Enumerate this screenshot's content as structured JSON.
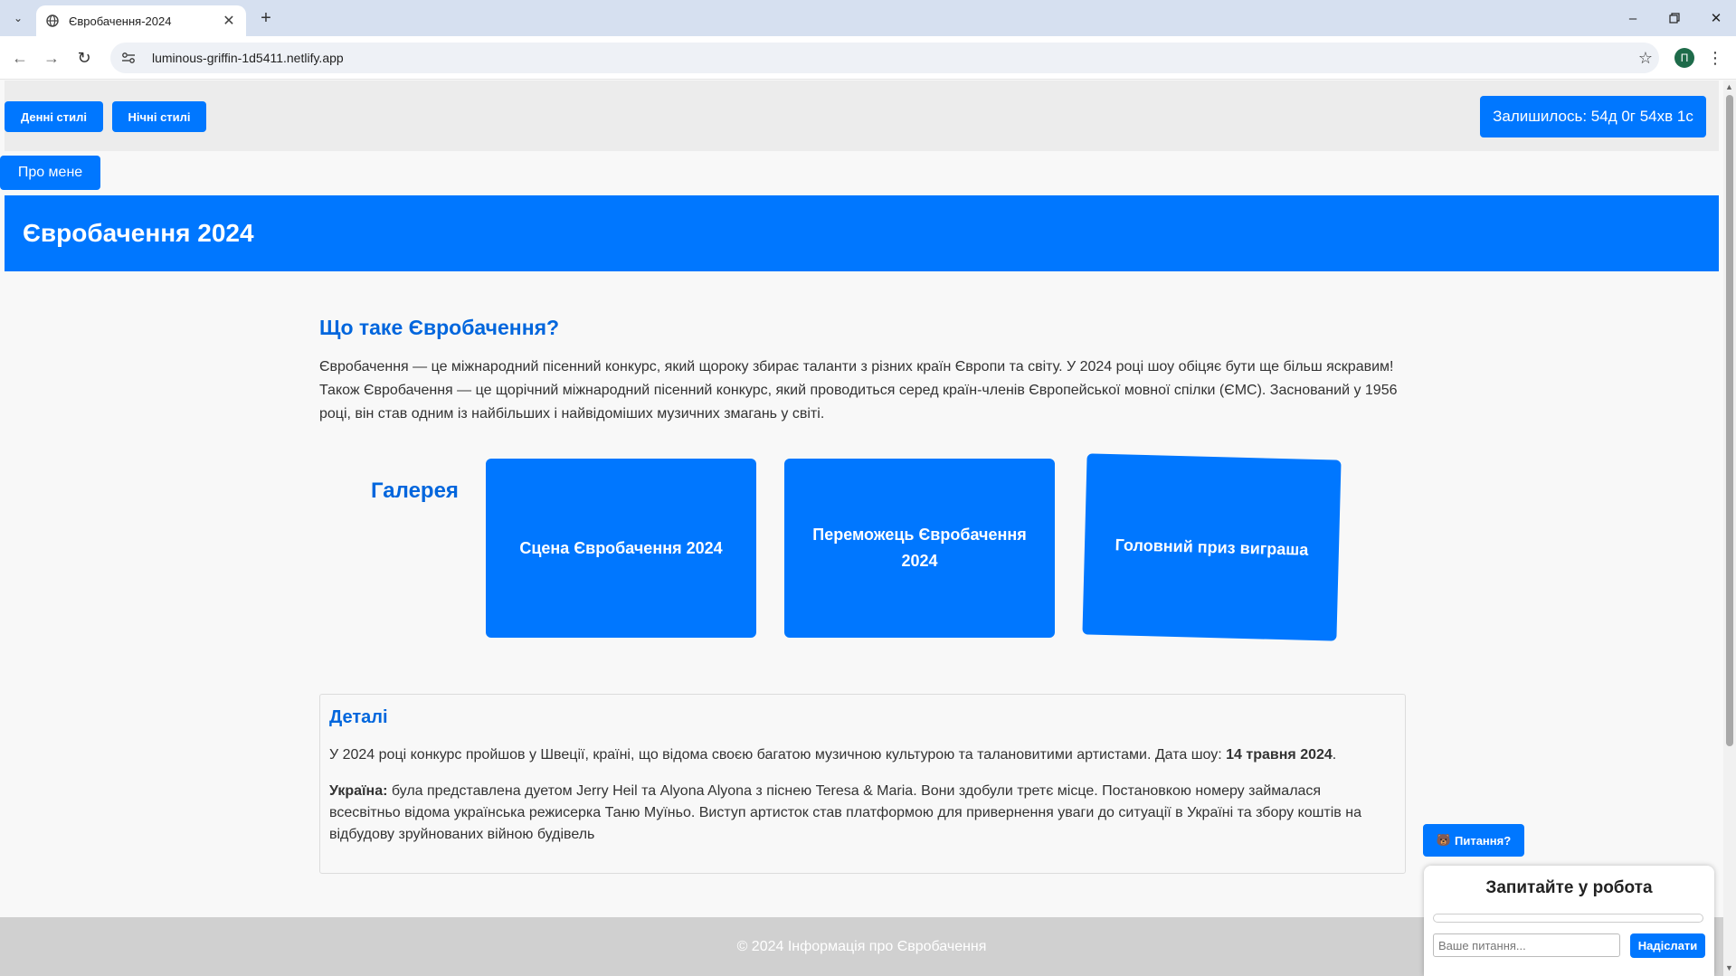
{
  "browser": {
    "tab_title": "Євробачення-2024",
    "url": "luminous-griffin-1d5411.netlify.app",
    "profile_initial": "П"
  },
  "header": {
    "day_styles_label": "Денні стилі",
    "night_styles_label": "Нічні стилі",
    "countdown_label": "Залишилось: 54д 0г 54хв 1с",
    "about_label": "Про мене",
    "site_title": "Євробачення 2024"
  },
  "intro": {
    "heading": "Що таке Євробачення?",
    "text": "Євробачення — це міжнародний пісенний конкурс, який щороку збирає таланти з різних країн Європи та світу. У 2024 році шоу обіцяє бути ще більш яскравим! Також Євробачення — це щорічний міжнародний пісенний конкурс, який проводиться серед країн-членів Європейської мовної спілки (ЄМС). Заснований у 1956 році, він став одним із найбільших і найвідоміших музичних змагань у світі."
  },
  "gallery": {
    "title": "Галерея",
    "cards": [
      {
        "label": "Сцена Євробачення 2024"
      },
      {
        "label": "Переможець Євробачення 2024"
      },
      {
        "label": "Головний приз виграша"
      }
    ]
  },
  "details": {
    "heading": "Деталі",
    "p1_text": "У 2024 році конкурс пройшов у Швеції, країні, що відома своєю багатою музичною культурою та талановитими артистами. Дата шоу: ",
    "p1_date": "14 травня 2024",
    "p1_end": ".",
    "p2_label": "Україна:",
    "p2_text": " була представлена дуетом Jerry Heil та Alyona Alyona з піснею Teresa & Maria. Вони здобули третє місце. Постановкою номеру займалася всесвітньо відома українська режисерка Таню Муїньо. Виступ артисток став платформою для привернення уваги до ситуації в Україні та збору коштів на відбудову зруйнованих війною будівель"
  },
  "footer": {
    "text": "© 2024 Інформація про Євробачення"
  },
  "chat": {
    "toggle_icon": "🐻",
    "toggle_label": "Питання?",
    "title": "Запитайте у робота",
    "input_placeholder": "Ваше питання...",
    "send_label": "Надіслати"
  },
  "colors": {
    "accent": "#0077ff",
    "heading": "#0066dd",
    "footer_bg": "#d0d0d0"
  }
}
